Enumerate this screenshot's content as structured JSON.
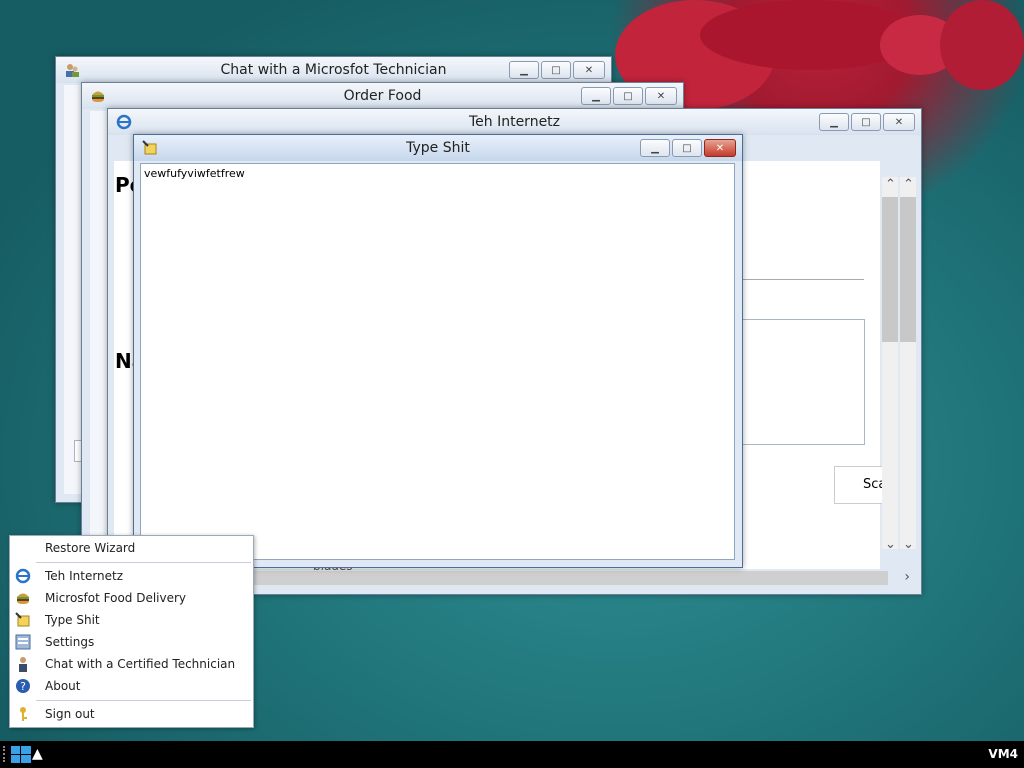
{
  "windows": {
    "chat": {
      "title": "Chat with a Microsfot Technician"
    },
    "food": {
      "title": "Order Food"
    },
    "internet": {
      "title": "Teh Internetz",
      "heading_fragment_1": "Pe",
      "heading_fragment_2": "Na",
      "button_fragment": "Scar",
      "bottom_text_fragment": "blades"
    },
    "typer": {
      "title": "Type Shit",
      "text_value": "vewfufyviwfetfrew"
    }
  },
  "start_menu": {
    "restore_label": "Restore Wizard",
    "items": [
      {
        "label": "Teh Internetz",
        "icon": "ie-icon"
      },
      {
        "label": "Microsfot Food Delivery",
        "icon": "burger-icon"
      },
      {
        "label": "Type Shit",
        "icon": "notepad-icon"
      },
      {
        "label": "Settings",
        "icon": "settings-icon"
      },
      {
        "label": "Chat with a Certified Technician",
        "icon": "technician-icon"
      },
      {
        "label": "About",
        "icon": "help-icon"
      }
    ],
    "signout_label": "Sign out"
  },
  "taskbar": {
    "machine_label": "VM4",
    "start_icon": "windows-logo-icon"
  },
  "colors": {
    "desktop": "#1f7479",
    "flower": "#b8213a",
    "close_red": "#c43a2a"
  }
}
